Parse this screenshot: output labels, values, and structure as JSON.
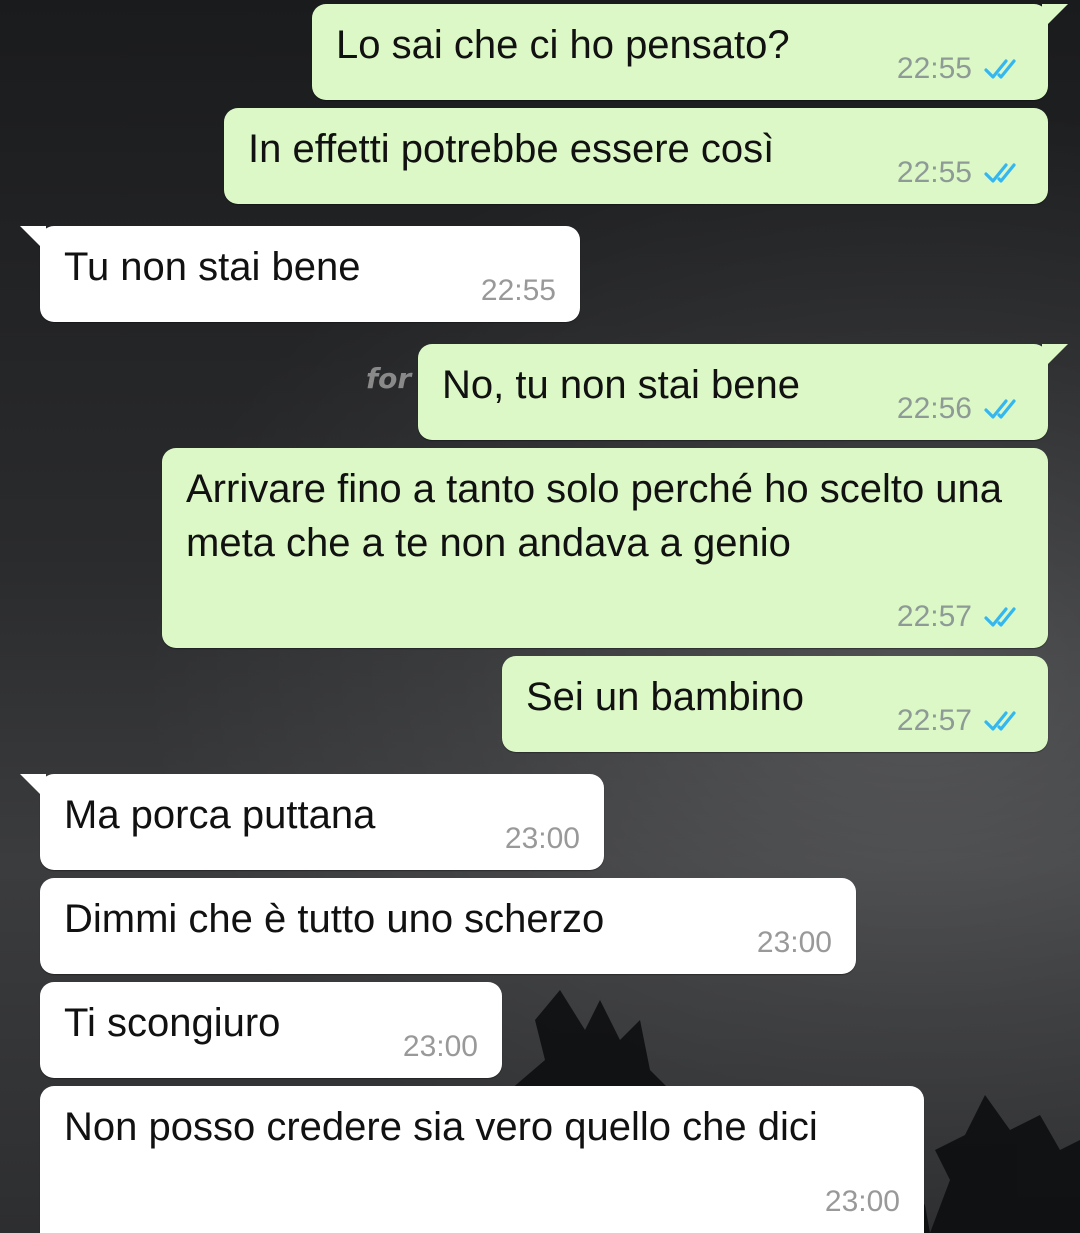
{
  "background": {
    "watermark_text": "for",
    "colors": {
      "sent_bubble": "#dcf8c6",
      "received_bubble": "#ffffff",
      "read_ticks": "#34b7f1",
      "timestamp": "#8e9a96"
    }
  },
  "messages": [
    {
      "direction": "sent",
      "text": "Lo sai che ci ho pensato?",
      "time": "22:55",
      "status_icon": "double-check-read-icon"
    },
    {
      "direction": "sent",
      "text": "In effetti potrebbe essere così",
      "time": "22:55",
      "status_icon": "double-check-read-icon"
    },
    {
      "direction": "received",
      "text": "Tu non stai bene",
      "time": "22:55"
    },
    {
      "direction": "sent",
      "text": "No, tu non stai bene",
      "time": "22:56",
      "status_icon": "double-check-read-icon"
    },
    {
      "direction": "sent",
      "text": "Arrivare fino a tanto solo perché ho scelto una meta che a te non andava a genio",
      "time": "22:57",
      "status_icon": "double-check-read-icon"
    },
    {
      "direction": "sent",
      "text": "Sei un bambino",
      "time": "22:57",
      "status_icon": "double-check-read-icon"
    },
    {
      "direction": "received",
      "text": "Ma porca puttana",
      "time": "23:00"
    },
    {
      "direction": "received",
      "text": "Dimmi che è tutto uno scherzo",
      "time": "23:00"
    },
    {
      "direction": "received",
      "text": "Ti scongiuro",
      "time": "23:00"
    },
    {
      "direction": "received",
      "text": "Non posso credere sia vero quello che dici",
      "time": "23:00"
    }
  ]
}
